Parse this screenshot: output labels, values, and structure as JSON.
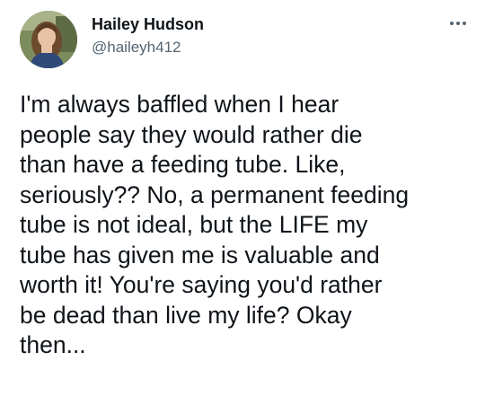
{
  "author": {
    "display_name": "Hailey Hudson",
    "handle": "@haileyh412",
    "avatar_icon": "profile-photo"
  },
  "menu": {
    "icon": "more-options-icon"
  },
  "tweet": {
    "lines": [
      "I'm always baffled when I hear",
      "people say they would rather die",
      "than have a feeding tube. Like,",
      "seriously?? No, a permanent feeding",
      "tube is not ideal, but the LIFE my",
      "tube has given me is valuable and",
      "worth it! You're saying you'd rather",
      "be dead than live my life? Okay",
      "then..."
    ]
  },
  "colors": {
    "text_primary": "#0f1419",
    "text_secondary": "#536471",
    "background": "#ffffff"
  }
}
